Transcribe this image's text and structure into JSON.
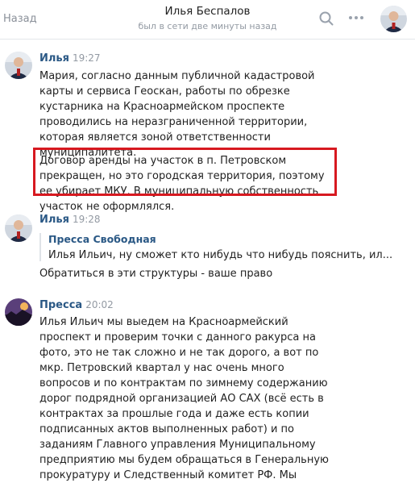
{
  "header": {
    "back_label": "Назад",
    "title": "Илья Беспалов",
    "status": "был в сети две минуты назад",
    "icons": [
      "search-icon",
      "more-icon",
      "avatar"
    ]
  },
  "messages": [
    {
      "author": "Илья",
      "time": "19:27",
      "paragraphs": [
        "Мария, согласно данным публичной кадастровой карты и сервиса Геоскан, работы по обрезке кустарника на Красноармейском проспекте проводились на неразграниченной территории, которая является зоной ответственности муниципалитета.",
        "Договор аренды на участок в п. Петровском прекращен, но это городская территория, поэтому ее убирает МКУ. В муниципальную собственность участок не оформлялся."
      ]
    },
    {
      "author": "Илья",
      "time": "19:28",
      "quote": {
        "author": "Пресса Свободная",
        "text": "Илья Ильич, ну сможет кто нибудь что нибудь пояснить, ил..."
      },
      "text": "Обратиться в эти структуры - ваше право"
    },
    {
      "author": "Пресса",
      "time": "20:02",
      "text": "Илья Ильич мы выедем на Красноармейский проспект и проверим точки с данного ракурса на фото, это не так сложно и не так дорого, а вот по мкр. Петровский квартал у нас очень много вопросов и по контрактам по зимнему содержанию дорог подрядной организацией АО САХ (всё есть в контрактах за прошлые года и даже есть копии подписанных актов выполненных работ) и по заданиям Главного управления Муниципальному предприятию мы будем обращаться в Генеральную прокуратуру и Следственный комитет РФ. Мы"
    }
  ],
  "colors": {
    "link": "#2a5885",
    "highlight_border": "#d71920",
    "muted": "#939aa3"
  }
}
